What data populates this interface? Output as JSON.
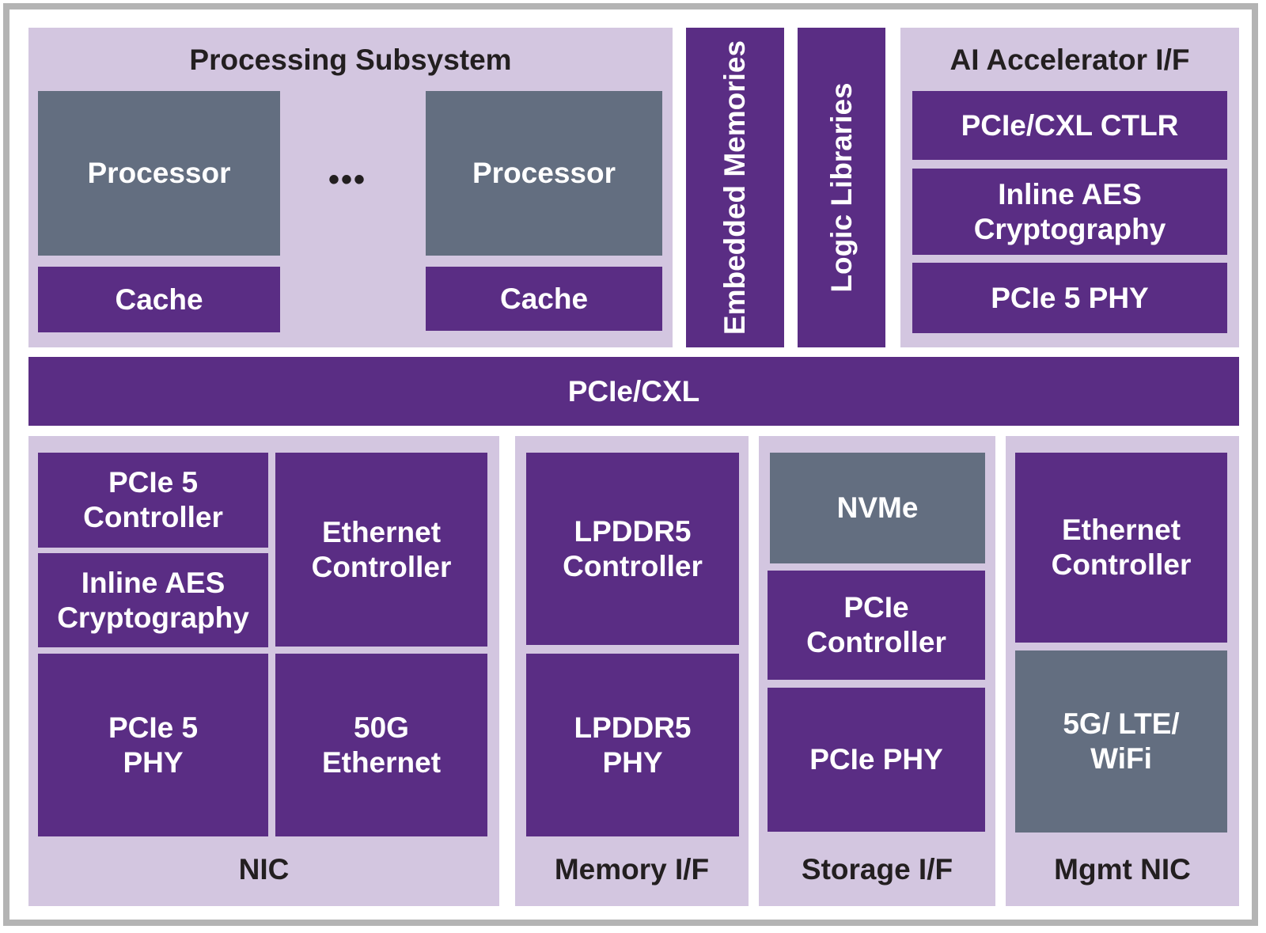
{
  "colors": {
    "block_purple": "#5a2d84",
    "block_gray": "#636e80",
    "panel_lavender": "#d3c6e0",
    "frame_gray": "#b4b4b4",
    "label_dark": "#231f20"
  },
  "processing_subsystem": {
    "title": "Processing Subsystem",
    "processors": [
      {
        "label": "Processor",
        "cache": "Cache"
      },
      {
        "label": "Processor",
        "cache": "Cache"
      }
    ],
    "ellipsis": "•••"
  },
  "embedded_memories": {
    "label": "Embedded\nMemories"
  },
  "logic_libraries": {
    "label": "Logic  Libraries"
  },
  "ai_accelerator": {
    "title": "AI Accelerator I/F",
    "blocks": [
      "PCIe/CXL CTLR",
      "Inline AES\nCryptography",
      "PCIe 5 PHY"
    ]
  },
  "bus": {
    "label": "PCIe/CXL"
  },
  "nic": {
    "title": "NIC",
    "blocks": [
      "PCIe 5\nController",
      "Inline AES\nCryptography",
      "PCIe 5\nPHY",
      "Ethernet\nController",
      "50G\nEthernet"
    ]
  },
  "memory_if": {
    "title": "Memory I/F",
    "blocks": [
      "LPDDR5\nController",
      "LPDDR5\nPHY"
    ]
  },
  "storage_if": {
    "title": "Storage I/F",
    "blocks": [
      "NVMe",
      "PCIe\nController",
      "PCIe PHY"
    ]
  },
  "mgmt_nic": {
    "title": "Mgmt NIC",
    "blocks": [
      "Ethernet\nController",
      "5G/ LTE/\nWiFi"
    ]
  }
}
